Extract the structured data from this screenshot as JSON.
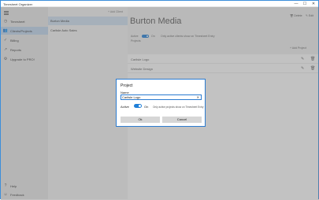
{
  "window": {
    "title": "Timesheet Organizer",
    "minimize": "—",
    "maximize": "☐",
    "close": "✕"
  },
  "sidebar": {
    "items": [
      {
        "icon": "clock-icon",
        "glyph": "◷",
        "label": "Timesheet"
      },
      {
        "icon": "people-icon",
        "glyph": "👥",
        "label": "Clients/Projects",
        "active": true
      },
      {
        "icon": "billing-icon",
        "glyph": "✓",
        "label": "Billing"
      },
      {
        "icon": "reports-icon",
        "glyph": "↗",
        "label": "Reports"
      },
      {
        "icon": "upgrade-icon",
        "glyph": "⚙",
        "label": "Upgrade to PRO!"
      }
    ],
    "bottom_items": [
      {
        "icon": "help-icon",
        "glyph": "?",
        "label": "Help"
      },
      {
        "icon": "feedback-icon",
        "glyph": "☺",
        "label": "Feedback"
      }
    ]
  },
  "clients": {
    "add_label": "+ Add Client",
    "items": [
      "Burton Media",
      "Carlisle Auto Sales"
    ]
  },
  "detail": {
    "client_name": "Burton Media",
    "delete_label": "Delete",
    "edit_label": "Edit",
    "active_label": "Active",
    "on_label": "On",
    "active_note": "Only active clients show on Timesheet Entry",
    "projects_label": "Projects",
    "add_project_label": "+ Add Project",
    "projects": [
      "Carlisle Logo",
      "Website Design"
    ]
  },
  "dialog": {
    "title": "Project",
    "name_label": "Name",
    "name_value": "Carlisle Logo",
    "active_label": "Active",
    "on_label": "On",
    "note": "Only active projects show on Timesheet Entry",
    "ok_label": "Ok",
    "cancel_label": "Cancel"
  },
  "colors": {
    "accent": "#1f7fd8",
    "sidebar_active": "#bfd6ee"
  }
}
